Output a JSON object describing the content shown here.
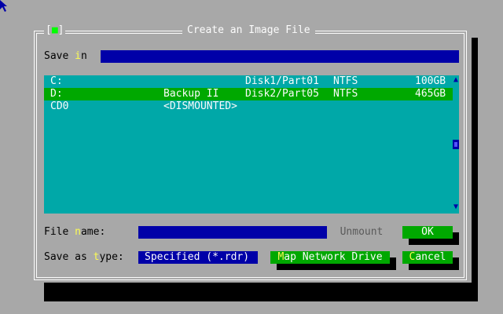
{
  "dialog": {
    "title": "Create an Image File",
    "close_open": "[",
    "close_mark": "■",
    "close_close": "]"
  },
  "save_in": {
    "label_pre": "Save ",
    "label_hot": "i",
    "label_post": "n",
    "value": ""
  },
  "drives": [
    {
      "name": "C:",
      "label": "",
      "partition": "Disk1/Part01",
      "fs": "NTFS",
      "size": "100GB",
      "selected": false
    },
    {
      "name": "D:",
      "label": "Backup II",
      "partition": "Disk2/Part05",
      "fs": "NTFS",
      "size": "465GB",
      "selected": true
    },
    {
      "name": "CD0",
      "label": "<DISMOUNTED>",
      "partition": "",
      "fs": "",
      "size": "",
      "selected": false
    }
  ],
  "scrollbar": {
    "up_arrow": "▲",
    "down_arrow": "▼"
  },
  "file_name": {
    "label_pre": "File ",
    "label_hot": "n",
    "label_post": "ame:",
    "value": ""
  },
  "save_as_type": {
    "label_pre": "Save as ",
    "label_hot": "t",
    "label_post": "ype:",
    "value": "Specified (*.rdr)"
  },
  "buttons": {
    "unmount": "Unmount",
    "ok": "OK",
    "map_hot": "M",
    "map_rest": "ap Network Drive",
    "cancel_hot": "C",
    "cancel_rest": "ancel"
  },
  "colors": {
    "background": "#a8a8a8",
    "list_bg": "#00a8a8",
    "selected_row": "#00a800",
    "field_blue": "#0000a8",
    "hotkey": "#fcfc54"
  },
  "icons": {
    "cursor": "mouse-pointer-icon",
    "close": "close-box-icon"
  }
}
